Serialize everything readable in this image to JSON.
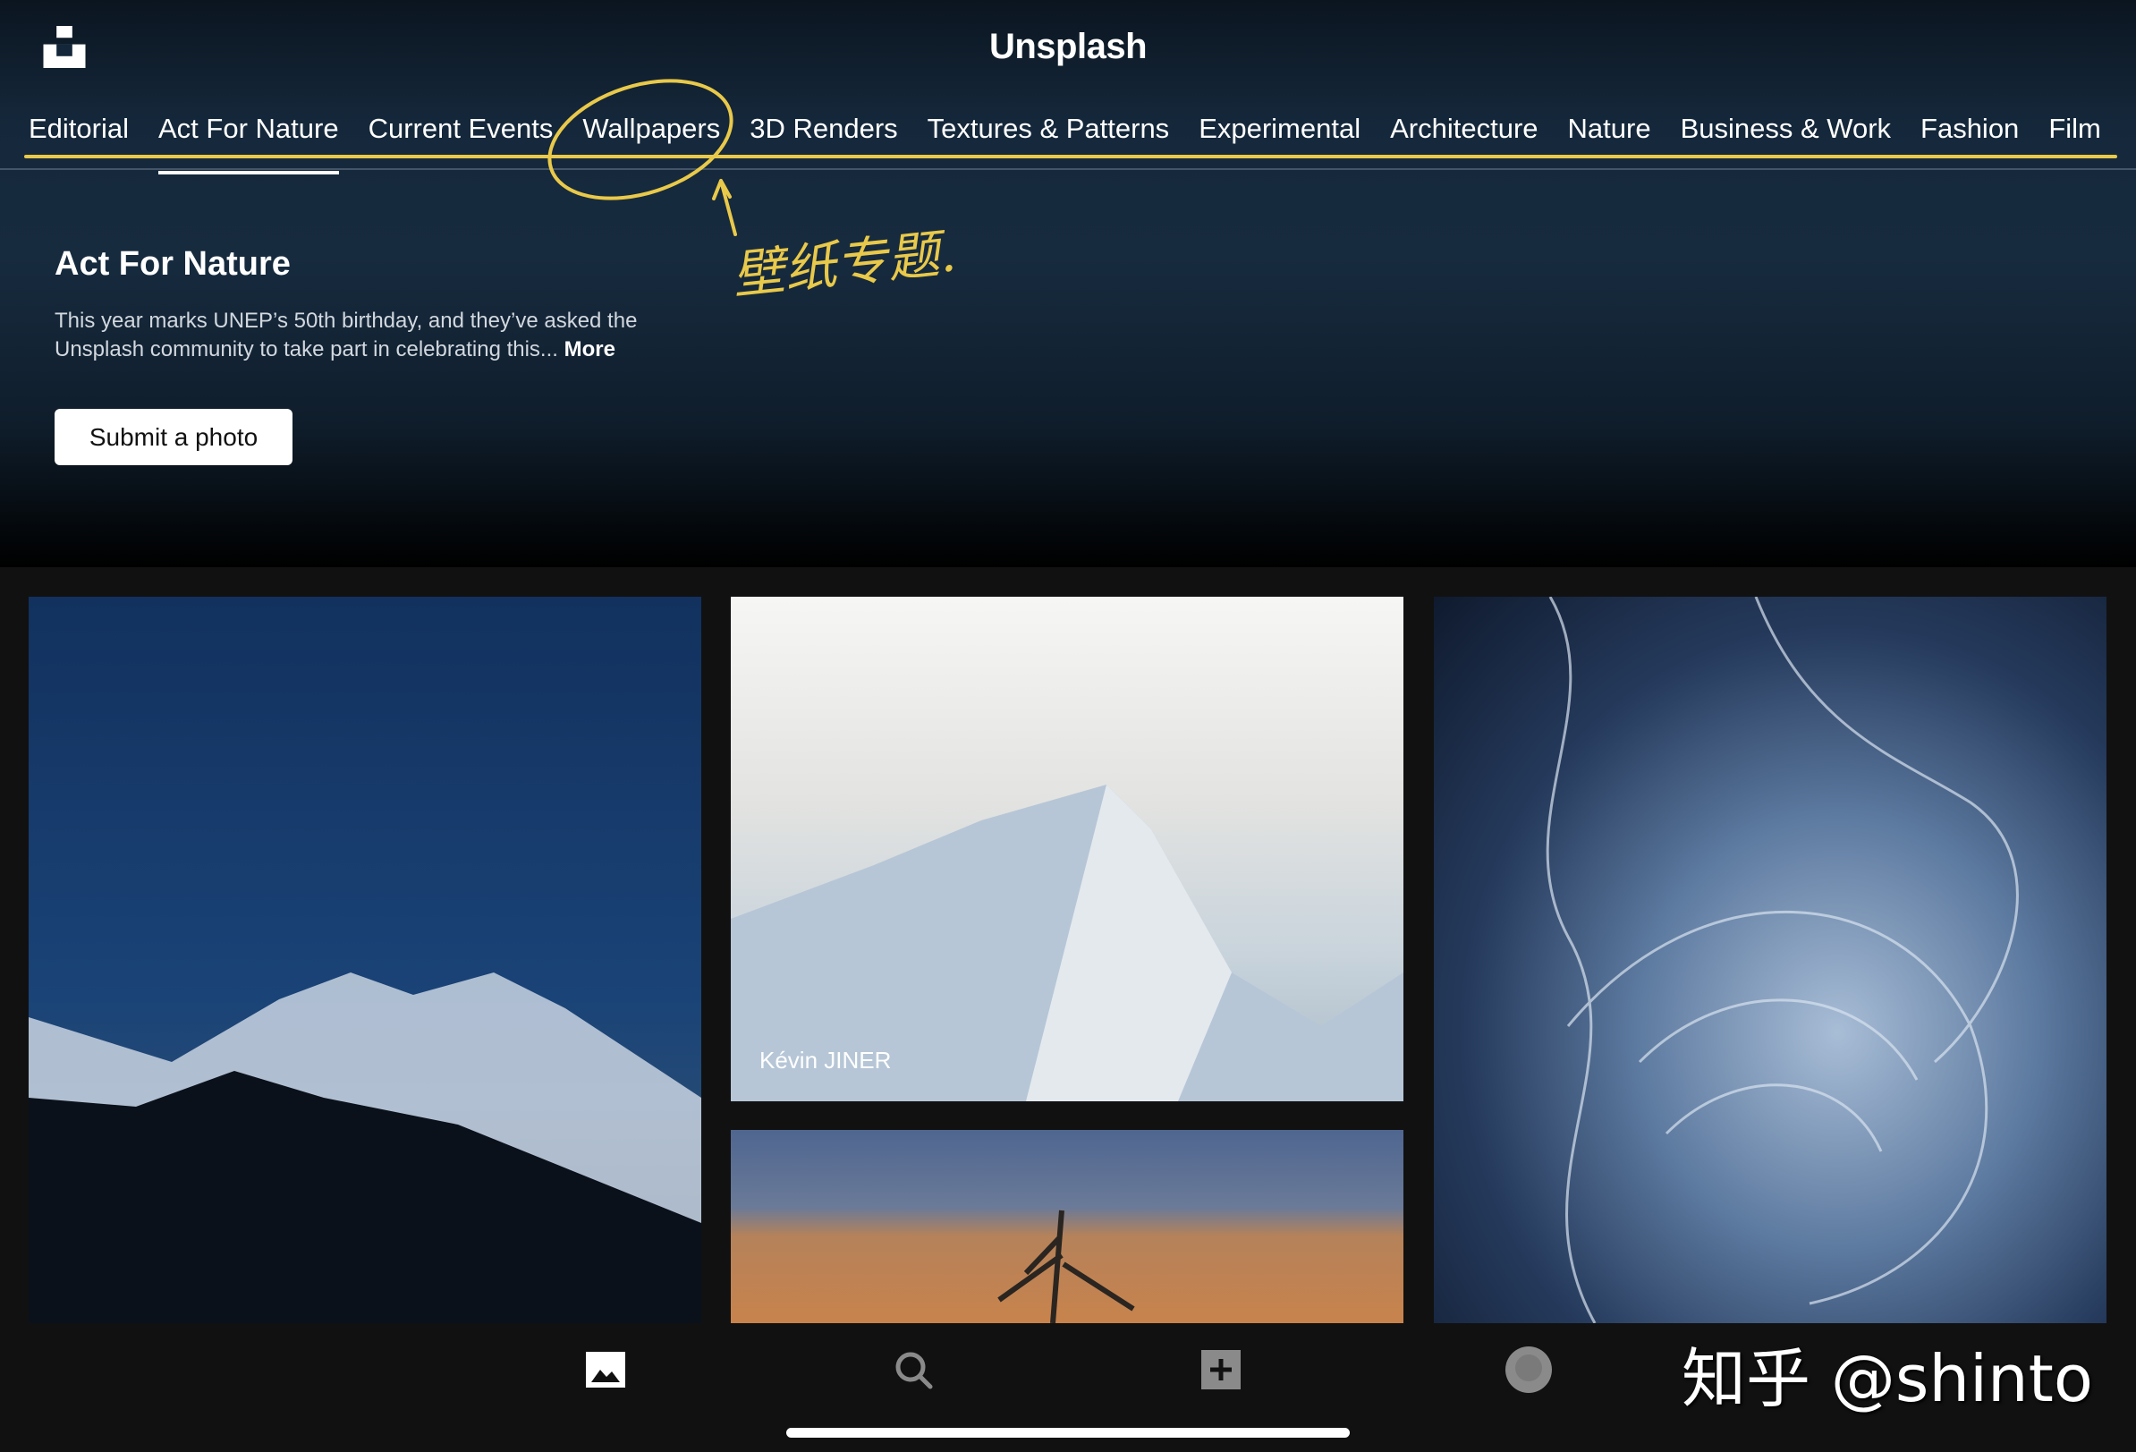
{
  "header": {
    "title": "Unsplash",
    "logo": "unsplash-logo-icon"
  },
  "tabs": [
    {
      "label": "Editorial",
      "active": false
    },
    {
      "label": "Act For Nature",
      "active": true
    },
    {
      "label": "Current Events",
      "active": false
    },
    {
      "label": "Wallpapers",
      "active": false
    },
    {
      "label": "3D Renders",
      "active": false
    },
    {
      "label": "Textures & Patterns",
      "active": false
    },
    {
      "label": "Experimental",
      "active": false
    },
    {
      "label": "Architecture",
      "active": false
    },
    {
      "label": "Nature",
      "active": false
    },
    {
      "label": "Business & Work",
      "active": false
    },
    {
      "label": "Fashion",
      "active": false
    },
    {
      "label": "Film",
      "active": false
    }
  ],
  "annotation": {
    "text": "壁纸专题.",
    "color": "#e9c94a"
  },
  "hero": {
    "title": "Act For Nature",
    "description": "This year marks UNEP’s 50th birthday, and they’ve asked the Unsplash community to take part in celebrating this...",
    "more": "More",
    "button": "Submit a photo"
  },
  "photos": [
    {
      "credit": ""
    },
    {
      "credit": "Kévin JINER"
    },
    {
      "credit": ""
    },
    {
      "credit": ""
    }
  ],
  "bottom_nav": [
    {
      "icon": "photos-icon",
      "active": true
    },
    {
      "icon": "search-icon"
    },
    {
      "icon": "add-icon"
    },
    {
      "icon": "avatar-icon"
    }
  ],
  "watermark": "知乎 @shinto"
}
